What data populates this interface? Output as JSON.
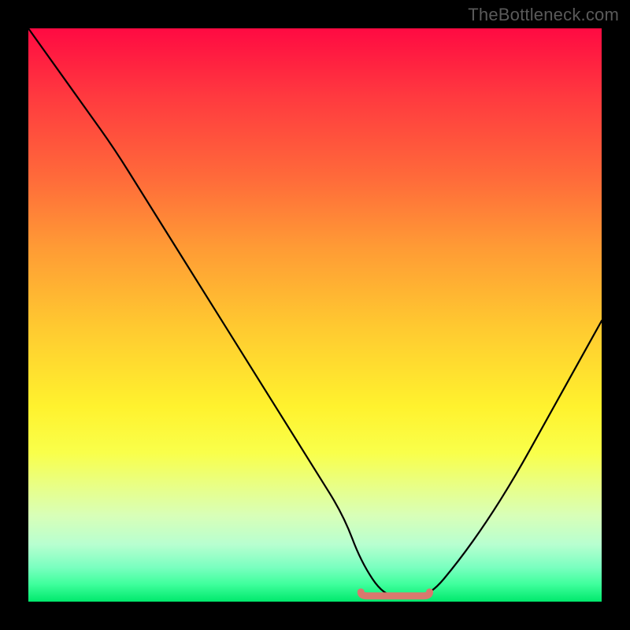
{
  "watermark": "TheBottleneck.com",
  "colors": {
    "background": "#000000",
    "curve": "#000000",
    "marker": "#d9786e"
  },
  "chart_data": {
    "type": "line",
    "title": "",
    "xlabel": "",
    "ylabel": "",
    "xlim": [
      0,
      100
    ],
    "ylim": [
      0,
      100
    ],
    "grid": false,
    "legend": false,
    "series": [
      {
        "name": "bottleneck-curve",
        "x": [
          0,
          5,
          10,
          15,
          20,
          25,
          30,
          35,
          40,
          45,
          50,
          55,
          58,
          62,
          66,
          70,
          75,
          80,
          85,
          90,
          95,
          100
        ],
        "y": [
          100,
          93,
          86,
          79,
          71,
          63,
          55,
          47,
          39,
          31,
          23,
          15,
          7,
          1,
          1,
          1,
          7,
          14,
          22,
          31,
          40,
          49
        ]
      }
    ],
    "markers": [
      {
        "name": "valley-flat",
        "x_start": 58,
        "x_end": 70,
        "y": 1
      }
    ],
    "gradient_stops": [
      {
        "pos": 0,
        "color": "#ff0a42"
      },
      {
        "pos": 12,
        "color": "#ff3a3f"
      },
      {
        "pos": 26,
        "color": "#ff6a3a"
      },
      {
        "pos": 38,
        "color": "#ff9a35"
      },
      {
        "pos": 52,
        "color": "#ffc930"
      },
      {
        "pos": 66,
        "color": "#fff22e"
      },
      {
        "pos": 74,
        "color": "#f9ff4a"
      },
      {
        "pos": 80,
        "color": "#e8ff88"
      },
      {
        "pos": 85,
        "color": "#d8ffb8"
      },
      {
        "pos": 90,
        "color": "#b8ffd0"
      },
      {
        "pos": 94,
        "color": "#7affc0"
      },
      {
        "pos": 97,
        "color": "#3eff9c"
      },
      {
        "pos": 100,
        "color": "#00e86c"
      }
    ]
  }
}
